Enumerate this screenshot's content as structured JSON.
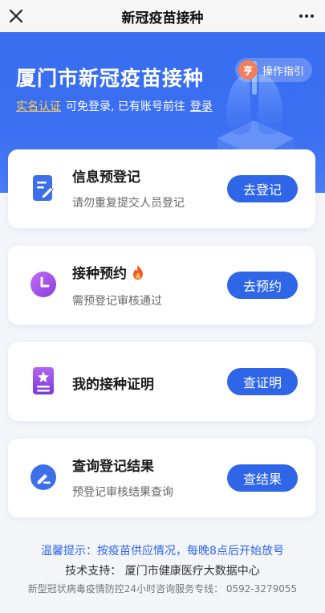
{
  "topbar": {
    "title": "新冠疫苗接种"
  },
  "hero": {
    "title": "厦门市新冠疫苗接种",
    "realname_link": "实名认证",
    "sub_text": "可免登录, 已有账号前往",
    "login_link": "登录",
    "guide_button": "操作指引",
    "guide_icon_glyph": "亨"
  },
  "cards": [
    {
      "title": "信息预登记",
      "desc": "请勿重复提交人员登记",
      "button": "去登记",
      "icon": "document-edit-icon",
      "color": "#3d6fe8"
    },
    {
      "title": "接种预约",
      "desc": "需预登记审核通过",
      "button": "去预约",
      "icon": "clock-icon",
      "color": "#a146e6"
    },
    {
      "title": "我的接种证明",
      "desc": "",
      "button": "查证明",
      "icon": "certificate-star-icon",
      "color": "#9a4fe0"
    },
    {
      "title": "查询登记结果",
      "desc": "预登记审核结果查询",
      "button": "查结果",
      "icon": "search-edit-icon",
      "color": "#3d6fe8"
    }
  ],
  "footer": {
    "tip": "温馨提示：按疫苗供应情况，每晚8点后开始放号",
    "support": "技术支持：  厦门市健康医疗大数据中心",
    "hotline": "新型冠状病毒疫情防控24小时咨询服务专线：  0592-3279055"
  },
  "colors": {
    "accent": "#2f66e8",
    "hero_bg": "#3a6ef0",
    "link_yellow": "#ffd34d"
  }
}
